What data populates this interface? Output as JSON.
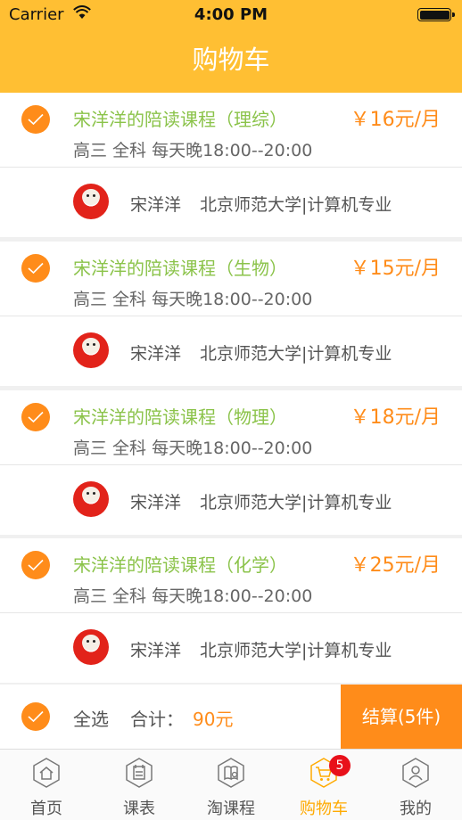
{
  "status_bar": {
    "carrier": "Carrier",
    "time": "4:00 PM"
  },
  "nav": {
    "title": "购物车"
  },
  "cart_items": [
    {
      "title": "宋洋洋的陪读课程（理综）",
      "price": "￥16元/月",
      "subtitle": "高三 全科 每天晚18:00--20:00",
      "teacher_name": "宋洋洋",
      "teacher_school": "北京师范大学|计算机专业",
      "checked": true
    },
    {
      "title": "宋洋洋的陪读课程（生物）",
      "price": "￥15元/月",
      "subtitle": "高三 全科 每天晚18:00--20:00",
      "teacher_name": "宋洋洋",
      "teacher_school": "北京师范大学|计算机专业",
      "checked": true
    },
    {
      "title": "宋洋洋的陪读课程（物理）",
      "price": "￥18元/月",
      "subtitle": "高三 全科 每天晚18:00--20:00",
      "teacher_name": "宋洋洋",
      "teacher_school": "北京师范大学|计算机专业",
      "checked": true
    },
    {
      "title": "宋洋洋的陪读课程（化学）",
      "price": "￥25元/月",
      "subtitle": "高三 全科 每天晚18:00--20:00",
      "teacher_name": "宋洋洋",
      "teacher_school": "北京师范大学|计算机专业",
      "checked": true
    }
  ],
  "summary": {
    "select_all_label": "全选",
    "total_label": "合计：",
    "total_value": "90元",
    "checkout_label": "结算(5件)"
  },
  "tabbar": {
    "items": [
      {
        "label": "首页",
        "icon": "home-icon"
      },
      {
        "label": "课表",
        "icon": "schedule-icon"
      },
      {
        "label": "淘课程",
        "icon": "course-search-icon"
      },
      {
        "label": "购物车",
        "icon": "cart-icon",
        "badge": "5",
        "active": true
      },
      {
        "label": "我的",
        "icon": "profile-icon"
      }
    ]
  },
  "colors": {
    "header": "#ffbf33",
    "accent": "#ff8c1a",
    "title_green": "#8bc34a",
    "badge_red": "#e8101a"
  }
}
